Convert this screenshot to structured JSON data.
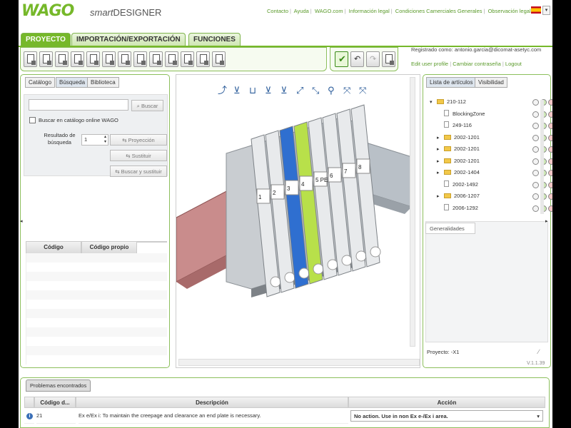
{
  "header": {
    "logo": "WAGO",
    "brand_smart": "smart",
    "brand_designer": "DESIGNER",
    "links": [
      "Contacto",
      "Ayuda",
      "WAGO.com",
      "Información legal",
      "Condiciones Camerciales Generales",
      "Observación legal"
    ],
    "lang_flag": "spain-flag-icon"
  },
  "menu": {
    "tabs": [
      "PROYECTO",
      "IMPORTACIÓN/EXPORTACIÓN",
      "FUNCIONES"
    ]
  },
  "user": {
    "registered": "Registrado como: antonio.garcia@dicomat-asetyc.com",
    "links": [
      "Edit user profile",
      "Cambiar contraseña",
      "Logout"
    ]
  },
  "left": {
    "tabs": [
      "Catálogo",
      "Búsqueda",
      "Biblioteca"
    ],
    "search_value": "",
    "search_button": "Buscar",
    "online_label": "Buscar en catálogo online WAGO",
    "result_label": "Resultado de búsqueda",
    "result_value": "1",
    "btn_projection": "Proyección",
    "btn_replace": "Sustituir",
    "btn_search_replace": "Buscar y sustituir",
    "columns": [
      "Código",
      "Código propio"
    ]
  },
  "canvas": {
    "terminals": [
      "1",
      "2",
      "3",
      "4",
      "5 PE",
      "6",
      "7",
      "8"
    ]
  },
  "right": {
    "tabs": [
      "Lista de artículos",
      "Visibilidad"
    ],
    "tree": [
      {
        "label": "210-112",
        "type": "folder",
        "indent": 0,
        "exp": "▾"
      },
      {
        "label": "BlockingZone",
        "type": "doc",
        "indent": 1,
        "exp": ""
      },
      {
        "label": "249-116",
        "type": "doc",
        "indent": 1,
        "exp": ""
      },
      {
        "label": "2002-1201",
        "type": "folder",
        "indent": 1,
        "exp": "▸"
      },
      {
        "label": "2002-1201",
        "type": "folder",
        "indent": 1,
        "exp": "▸"
      },
      {
        "label": "2002-1201",
        "type": "folder",
        "indent": 1,
        "exp": "▸"
      },
      {
        "label": "2002-1404",
        "type": "folder",
        "indent": 1,
        "exp": "▸"
      },
      {
        "label": "2002-1492",
        "type": "doc",
        "indent": 1,
        "exp": ""
      },
      {
        "label": "2006-1207",
        "type": "folder",
        "indent": 1,
        "exp": "▸"
      },
      {
        "label": "2006-1292",
        "type": "doc",
        "indent": 1,
        "exp": ""
      }
    ],
    "general_tab": "Generalidades",
    "project": "Proyecto: -X1",
    "version": "V.1.1.39"
  },
  "bottom": {
    "tab": "Problemas encontrados",
    "columns": [
      "Código d...",
      "Descripción",
      "Acción"
    ],
    "row": {
      "code": "21",
      "desc": "Ex e/Ex i: To maintain the creepage and clearance an end plate is necessary.",
      "action": "No action. Use in non Ex e-/Ex i area."
    }
  },
  "colors": {
    "accent": "#76b82a",
    "blue": "#2f6fd0",
    "green_hl": "#b8e04a"
  }
}
